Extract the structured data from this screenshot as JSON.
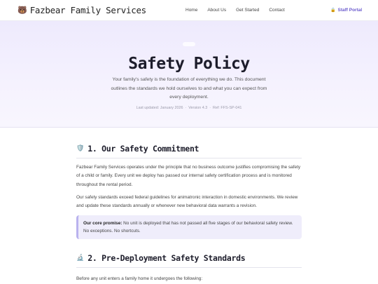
{
  "nav": {
    "brand_icon": "🐻",
    "brand_name": "Fazbear Family Services",
    "links": [
      "Home",
      "About Us",
      "Get Started",
      "Contact"
    ],
    "staff_icon": "🔒",
    "staff_label": "Staff Portal"
  },
  "hero": {
    "title": "Safety Policy",
    "subtitle": "Your family's safety is the foundation of everything we do. This document outlines the standards we hold ourselves to and what you can expect from every deployment.",
    "meta": {
      "updated": "Last updated: January 2026",
      "version": "Version 4.3",
      "ref": "Ref: FFS-SP-041"
    }
  },
  "section1": {
    "icon": "🛡️",
    "title": "1. Our Safety Commitment",
    "para1": "Fazbear Family Services operates under the principle that no business outcome justifies compromising the safety of a child or family. Every unit we deploy has passed our internal safety certification process and is monitored throughout the rental period.",
    "para2": "Our safety standards exceed federal guidelines for animatronic interaction in domestic environments. We review and update these standards annually or whenever new behavioral data warrants a revision.",
    "callout_label": "Our core promise:",
    "callout_text": " No unit is deployed that has not passed all five stages of our behavioral safety review. No exceptions. No shortcuts."
  },
  "section2": {
    "icon": "🔬",
    "title": "2. Pre-Deployment Safety Standards",
    "para1": "Before any unit enters a family home it undergoes the following:"
  }
}
